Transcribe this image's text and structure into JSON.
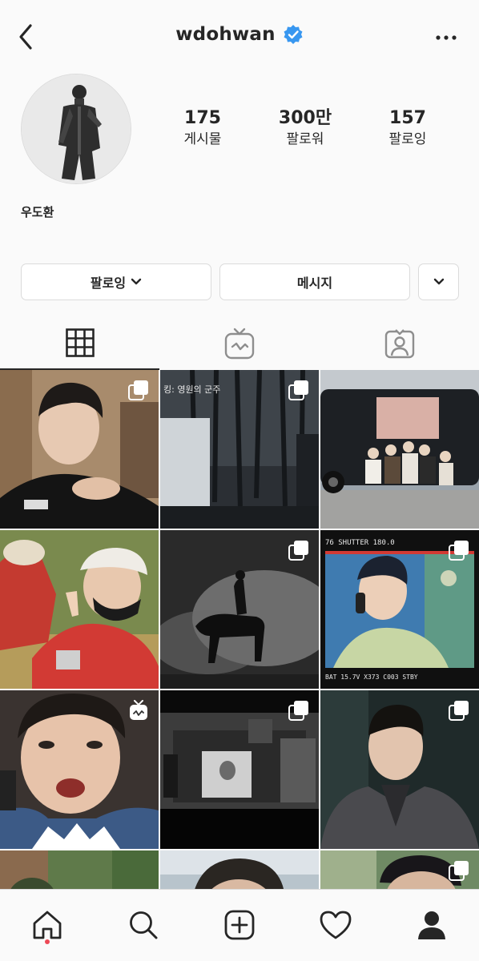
{
  "header": {
    "username": "wdohwan",
    "verified": true,
    "back_icon": "chevron-left-icon",
    "more_icon": "more-horizontal-icon"
  },
  "profile": {
    "display_name": "우도환",
    "stats": [
      {
        "value": "175",
        "label": "게시물"
      },
      {
        "value": "300만",
        "label": "팔로워"
      },
      {
        "value": "157",
        "label": "팔로잉"
      }
    ]
  },
  "actions": {
    "following_label": "팔로잉",
    "message_label": "메시지"
  },
  "tabs": [
    {
      "name": "grid",
      "icon": "grid-icon",
      "active": true
    },
    {
      "name": "igtv",
      "icon": "igtv-icon",
      "active": false
    },
    {
      "name": "tagged",
      "icon": "tagged-person-icon",
      "active": false
    }
  ],
  "posts": [
    {
      "type": "carousel"
    },
    {
      "type": "carousel",
      "caption_text": "킹: 영원의 군주"
    },
    {
      "type": "single"
    },
    {
      "type": "single"
    },
    {
      "type": "carousel"
    },
    {
      "type": "carousel",
      "overlay_text": "SHUTTER 180.0"
    },
    {
      "type": "igtv"
    },
    {
      "type": "carousel"
    },
    {
      "type": "carousel"
    },
    {
      "type": "single"
    },
    {
      "type": "single"
    },
    {
      "type": "carousel"
    }
  ],
  "bottom_nav": [
    {
      "name": "home",
      "icon": "home-icon",
      "active": true
    },
    {
      "name": "search",
      "icon": "search-icon"
    },
    {
      "name": "new-post",
      "icon": "plus-square-icon"
    },
    {
      "name": "activity",
      "icon": "heart-icon"
    },
    {
      "name": "profile",
      "icon": "profile-icon"
    }
  ],
  "colors": {
    "verified_blue": "#3897f0",
    "text": "#262626",
    "border": "#dbdbdb",
    "notification_dot": "#ed4956"
  }
}
